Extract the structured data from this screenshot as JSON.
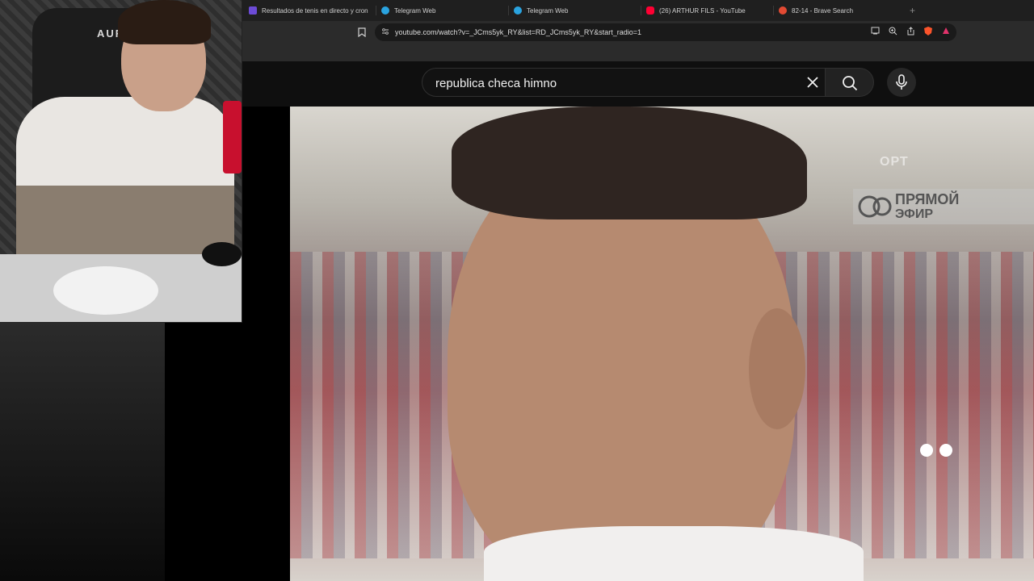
{
  "webcam": {
    "chair_brand": "AURE"
  },
  "tabs": [
    {
      "title": "Resultados de tenis en directo y cron",
      "icon": "sofascore-icon",
      "color": "#6c4bd6"
    },
    {
      "title": "Telegram Web",
      "icon": "telegram-icon",
      "color": "#2aa3df"
    },
    {
      "title": "Telegram Web",
      "icon": "telegram-icon",
      "color": "#2aa3df"
    },
    {
      "title": "(26) ARTHUR FILS - YouTube",
      "icon": "youtube-icon",
      "color": "#ff0033"
    },
    {
      "title": "82-14 - Brave Search",
      "icon": "brave-search-icon",
      "color": "#e24a33"
    }
  ],
  "new_tab_label": "+",
  "url": "youtube.com/watch?v=_JCms5yk_RY&list=RD_JCms5yk_RY&start_radio=1",
  "search": {
    "query": "republica checa himno"
  },
  "video": {
    "broadcast_logo": "ОРТ",
    "live_line1": "ПРЯМОЙ",
    "live_line2": "ЭФИР"
  }
}
